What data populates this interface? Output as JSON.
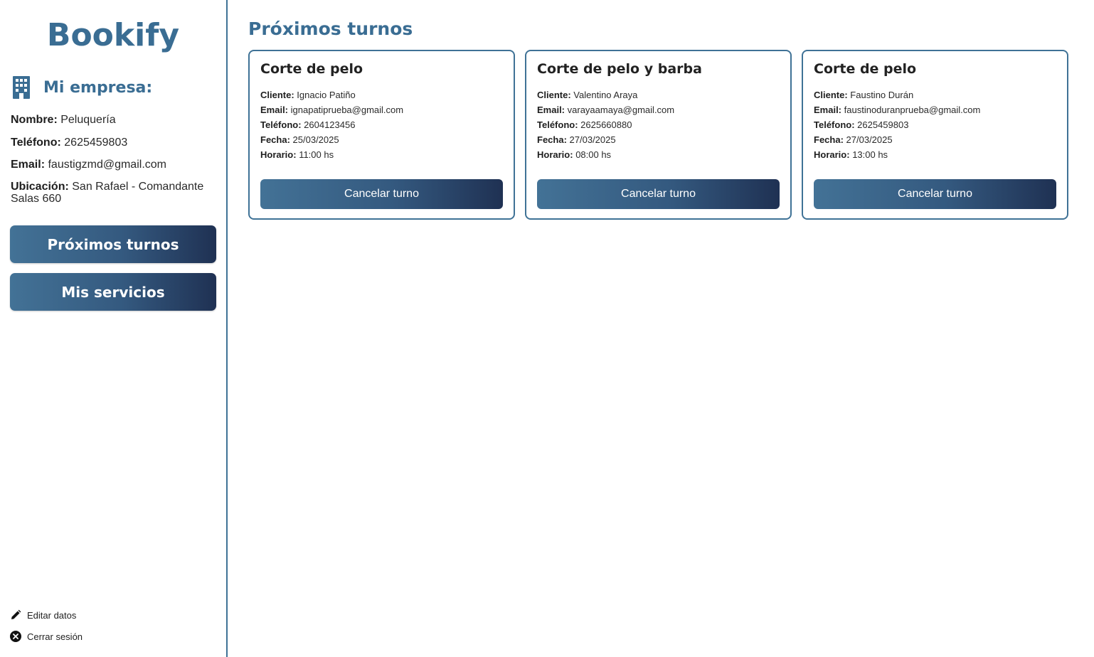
{
  "app": {
    "logo": "Bookify"
  },
  "sidebar": {
    "company_title": "Mi empresa:",
    "company_icon": "building-icon",
    "info": [
      {
        "label": "Nombre:",
        "value": "Peluquería"
      },
      {
        "label": "Teléfono:",
        "value": "2625459803"
      },
      {
        "label": "Email:",
        "value": "faustigzmd@gmail.com"
      },
      {
        "label": "Ubicación:",
        "value": "San Rafael - Comandante Salas 660"
      }
    ],
    "nav": [
      {
        "label": "Próximos turnos"
      },
      {
        "label": "Mis servicios"
      }
    ],
    "footer": [
      {
        "label": "Editar datos",
        "icon": "pencil-icon"
      },
      {
        "label": "Cerrar sesión",
        "icon": "close-circle-icon"
      }
    ]
  },
  "main": {
    "title": "Próximos turnos",
    "field_labels": {
      "cliente": "Cliente:",
      "email": "Email:",
      "telefono": "Teléfono:",
      "fecha": "Fecha:",
      "horario": "Horario:"
    },
    "cards": [
      {
        "service": "Corte de pelo",
        "cliente": "Ignacio Patiño",
        "email": "ignapatiprueba@gmail.com",
        "telefono": "2604123456",
        "fecha": "25/03/2025",
        "horario": "11:00 hs",
        "cancel_label": "Cancelar turno"
      },
      {
        "service": "Corte de pelo y barba",
        "cliente": "Valentino Araya",
        "email": "varayaamaya@gmail.com",
        "telefono": "2625660880",
        "fecha": "27/03/2025",
        "horario": "08:00 hs",
        "cancel_label": "Cancelar turno"
      },
      {
        "service": "Corte de pelo",
        "cliente": "Faustino Durán",
        "email": "faustinoduranprueba@gmail.com",
        "telefono": "2625459803",
        "fecha": "27/03/2025",
        "horario": "13:00 hs",
        "cancel_label": "Cancelar turno"
      }
    ]
  },
  "colors": {
    "accent": "#3a6d93",
    "border": "#3f7296",
    "gradient_start": "#437296",
    "gradient_end": "#1f3153"
  }
}
